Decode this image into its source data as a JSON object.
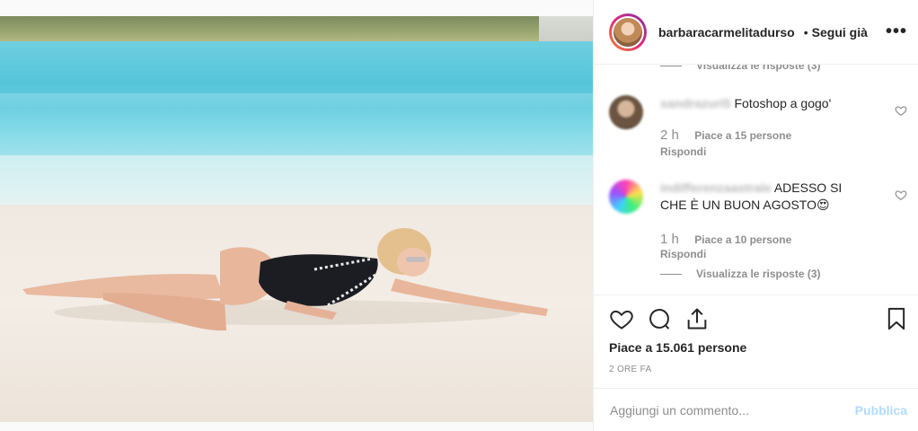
{
  "post": {
    "username": "barbaracarmelitadurso",
    "separator": "•",
    "follow_label": "Segui già",
    "more_label": "•••"
  },
  "comments": {
    "top_view_replies": "Visualizza le risposte (3)",
    "items": [
      {
        "username": "sandrazuri5",
        "text": "Fotoshop a gogo'",
        "time": "2 h",
        "likes": "Piace a 15 persone",
        "reply_label": "Rispondi"
      },
      {
        "username": "indifferenzaastrale",
        "text": "ADESSO SI CHE È UN BUON AGOSTO😍",
        "time": "1 h",
        "likes": "Piace a 10 persone",
        "reply_label": "Rispondi",
        "view_replies": "Visualizza le risposte (3)"
      }
    ]
  },
  "actions": {
    "like_icon": "heart-icon",
    "comment_icon": "comment-bubble-icon",
    "share_icon": "share-icon",
    "save_icon": "bookmark-icon"
  },
  "likes_total": "Piace a 15.061 persone",
  "posted_ago": "2 ORE FA",
  "add_comment": {
    "placeholder": "Aggiungi un commento...",
    "post_label": "Pubblica"
  },
  "colors": {
    "accent_disabled": "#b3dbff",
    "muted_text": "#8e8e8e",
    "primary_text": "#262626",
    "border": "#efefef"
  }
}
